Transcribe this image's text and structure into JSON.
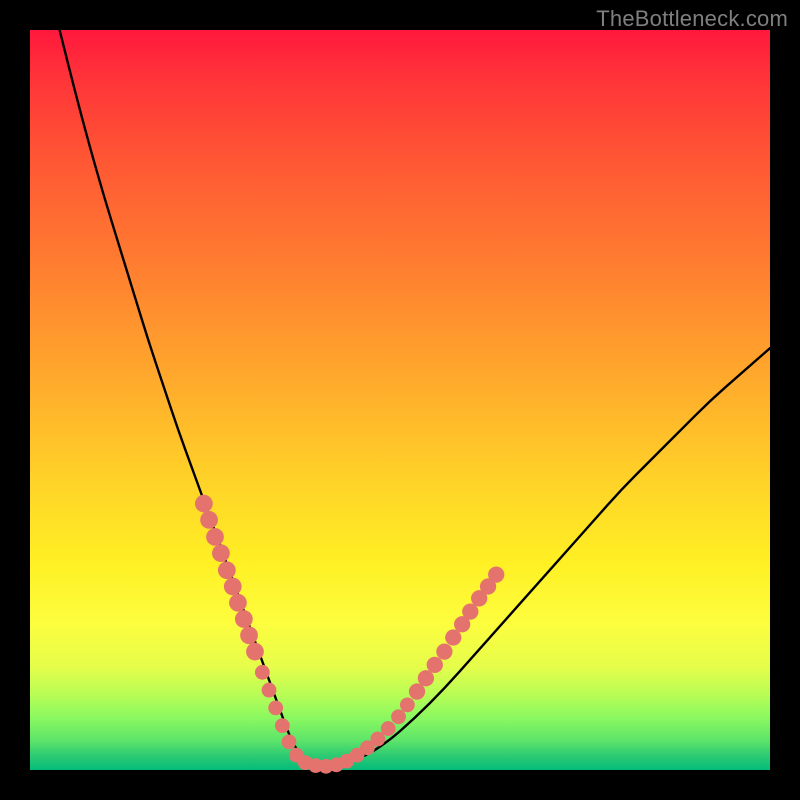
{
  "watermark": "TheBottleneck.com",
  "colors": {
    "curve_stroke": "#000000",
    "dot_fill": "#e4736e",
    "background_black": "#000000",
    "gradient_top": "#ff183c",
    "gradient_bottom": "#04bc7a"
  },
  "chart_data": {
    "type": "line",
    "title": "",
    "xlabel": "",
    "ylabel": "",
    "xlim": [
      0,
      100
    ],
    "ylim": [
      0,
      100
    ],
    "grid": false,
    "legend": false,
    "series": [
      {
        "name": "bottleneck-curve",
        "x": [
          4,
          6,
          8,
          10,
          12,
          14,
          16,
          18,
          20,
          22,
          24,
          26,
          28,
          30,
          32,
          34,
          35,
          36,
          37,
          38,
          40,
          44,
          48,
          52,
          56,
          60,
          64,
          68,
          72,
          76,
          80,
          84,
          88,
          92,
          96,
          100
        ],
        "y": [
          100,
          92,
          84.5,
          77.5,
          71,
          64.5,
          58,
          52,
          46,
          40.5,
          35,
          29.5,
          24,
          18.5,
          13,
          7.5,
          4.8,
          2.8,
          1.5,
          0.8,
          0.5,
          1.2,
          3.5,
          7,
          11,
          15.5,
          20,
          24.5,
          29,
          33.5,
          38,
          42,
          46,
          50,
          53.5,
          57
        ]
      }
    ],
    "annotations": {
      "dots_note": "salmon dots mark the lower band of the curve",
      "dots": [
        {
          "x": 23.5,
          "y": 36.0,
          "r": 1.2
        },
        {
          "x": 24.2,
          "y": 33.8,
          "r": 1.2
        },
        {
          "x": 25.0,
          "y": 31.5,
          "r": 1.2
        },
        {
          "x": 25.8,
          "y": 29.3,
          "r": 1.2
        },
        {
          "x": 26.6,
          "y": 27.0,
          "r": 1.2
        },
        {
          "x": 27.4,
          "y": 24.8,
          "r": 1.2
        },
        {
          "x": 28.1,
          "y": 22.6,
          "r": 1.2
        },
        {
          "x": 28.9,
          "y": 20.4,
          "r": 1.2
        },
        {
          "x": 29.6,
          "y": 18.2,
          "r": 1.2
        },
        {
          "x": 30.4,
          "y": 16.0,
          "r": 1.2
        },
        {
          "x": 31.4,
          "y": 13.2,
          "r": 1.0
        },
        {
          "x": 32.3,
          "y": 10.8,
          "r": 1.0
        },
        {
          "x": 33.2,
          "y": 8.4,
          "r": 1.0
        },
        {
          "x": 34.1,
          "y": 6.0,
          "r": 1.0
        },
        {
          "x": 35.0,
          "y": 3.8,
          "r": 1.0
        },
        {
          "x": 36.0,
          "y": 2.0,
          "r": 1.0
        },
        {
          "x": 37.2,
          "y": 1.0,
          "r": 1.0
        },
        {
          "x": 38.6,
          "y": 0.6,
          "r": 1.0
        },
        {
          "x": 40.0,
          "y": 0.5,
          "r": 1.0
        },
        {
          "x": 41.4,
          "y": 0.7,
          "r": 1.0
        },
        {
          "x": 42.8,
          "y": 1.2,
          "r": 1.0
        },
        {
          "x": 44.2,
          "y": 2.0,
          "r": 1.0
        },
        {
          "x": 45.6,
          "y": 3.0,
          "r": 1.0
        },
        {
          "x": 47.0,
          "y": 4.2,
          "r": 1.0
        },
        {
          "x": 48.4,
          "y": 5.6,
          "r": 1.0
        },
        {
          "x": 49.8,
          "y": 7.2,
          "r": 1.0
        },
        {
          "x": 51.0,
          "y": 8.8,
          "r": 1.0
        },
        {
          "x": 52.3,
          "y": 10.6,
          "r": 1.1
        },
        {
          "x": 53.5,
          "y": 12.4,
          "r": 1.1
        },
        {
          "x": 54.7,
          "y": 14.2,
          "r": 1.1
        },
        {
          "x": 56.0,
          "y": 16.0,
          "r": 1.1
        },
        {
          "x": 57.2,
          "y": 17.9,
          "r": 1.1
        },
        {
          "x": 58.4,
          "y": 19.7,
          "r": 1.1
        },
        {
          "x": 59.5,
          "y": 21.4,
          "r": 1.1
        },
        {
          "x": 60.7,
          "y": 23.2,
          "r": 1.1
        },
        {
          "x": 61.9,
          "y": 24.8,
          "r": 1.1
        },
        {
          "x": 63.0,
          "y": 26.4,
          "r": 1.1
        }
      ]
    }
  }
}
